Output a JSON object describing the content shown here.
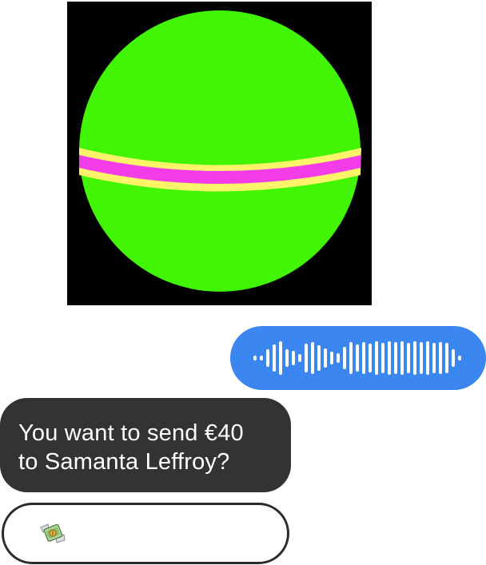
{
  "avatar": {
    "icon": "green-sphere-avatar",
    "colors": {
      "background": "#000000",
      "sphere": "#41f505",
      "outer_band": "#fff36a",
      "inner_band": "#f23cea"
    }
  },
  "voice_message": {
    "icon": "audio-waveform-icon",
    "bubble_color": "#3b86f0",
    "wave_color": "#ffffff"
  },
  "reply": {
    "line1": "You want to send €40",
    "line2": "to Samanta Leffroy?",
    "bubble_color": "#333333"
  },
  "composer": {
    "icon": "money-with-wings-icon"
  }
}
